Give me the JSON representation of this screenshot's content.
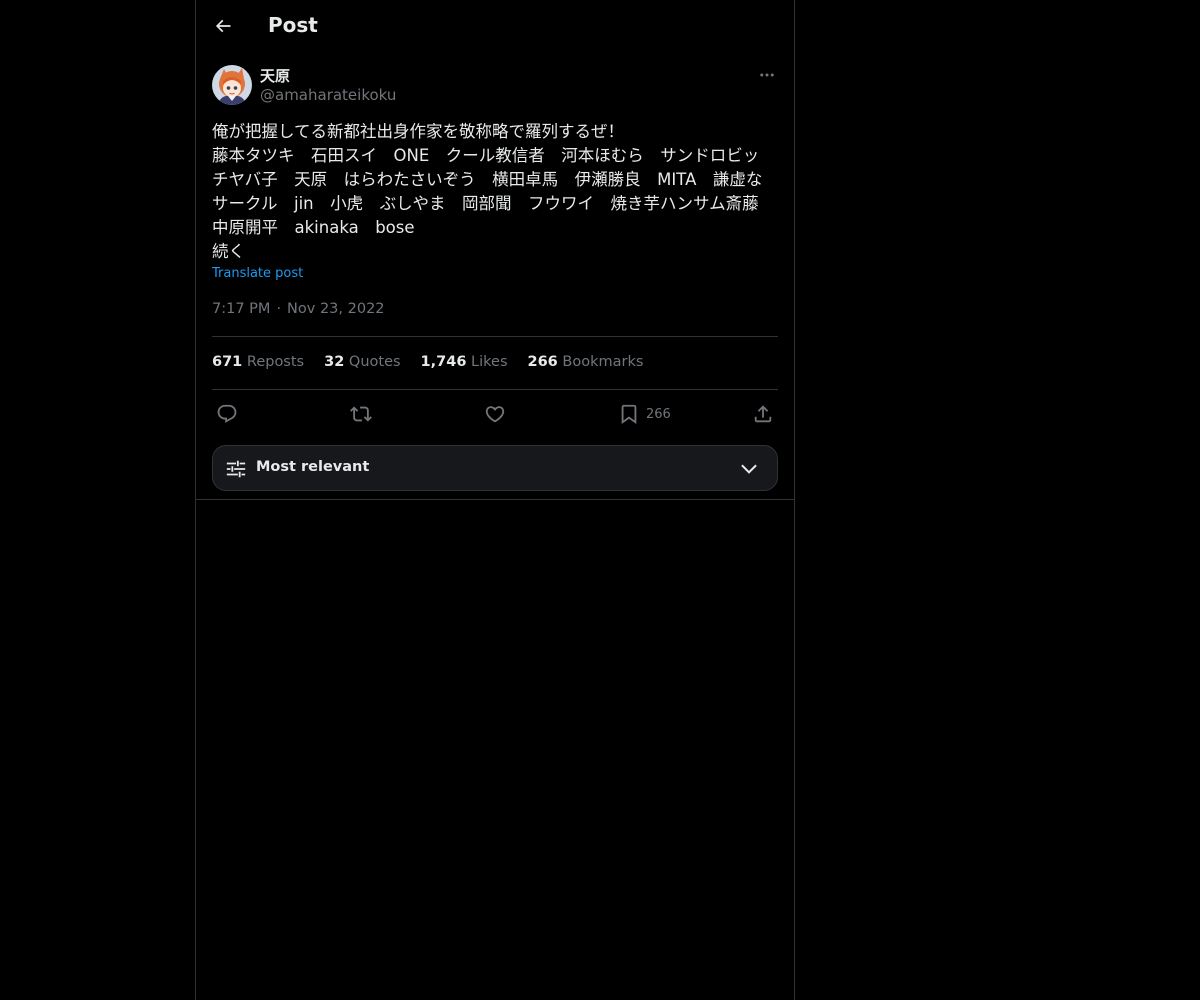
{
  "header": {
    "back_icon": "arrow-left-icon",
    "title": "Post"
  },
  "post": {
    "author": {
      "display_name": "天原",
      "handle": "@amaharateikoku",
      "avatar_icon": "avatar-illustration"
    },
    "more_icon": "more-horizontal-icon",
    "text_lines": [
      "俺が把握してる新都社出身作家を敬称略で羅列するぜ！",
      "藤本タツキ　石田スイ　ONE　クール教信者　河本ほむら　サンドロビッ",
      "チヤバ子　天原　はらわたさいぞう　横田卓馬　伊瀬勝良　MITA　謙虚な",
      "サークル　jin　小虎　ぶしやま　岡部聞　フウワイ　焼き芋ハンサム斎藤",
      "中原開平　akinaka　bose",
      "続く"
    ],
    "translate_label": "Translate post",
    "time": "7:17 PM",
    "date_separator": "·",
    "date": "Nov 23, 2022",
    "stats": [
      {
        "count": "671",
        "label": "Reposts"
      },
      {
        "count": "32",
        "label": "Quotes"
      },
      {
        "count": "1,746",
        "label": "Likes"
      },
      {
        "count": "266",
        "label": "Bookmarks"
      }
    ],
    "actions": {
      "reply_icon": "reply-icon",
      "repost_icon": "repost-icon",
      "like_icon": "heart-icon",
      "bookmark_icon": "bookmark-icon",
      "bookmark_count": "266",
      "share_icon": "share-icon"
    }
  },
  "replies_sort": {
    "icon": "sliders-icon",
    "label": "Most relevant",
    "chevron_icon": "chevron-down-icon"
  },
  "colors": {
    "background": "#000000",
    "text_primary": "#e7e9ea",
    "text_secondary": "#71767b",
    "accent": "#1d9bf0",
    "border": "#2f3336",
    "sort_bar_bg": "#16181c"
  }
}
